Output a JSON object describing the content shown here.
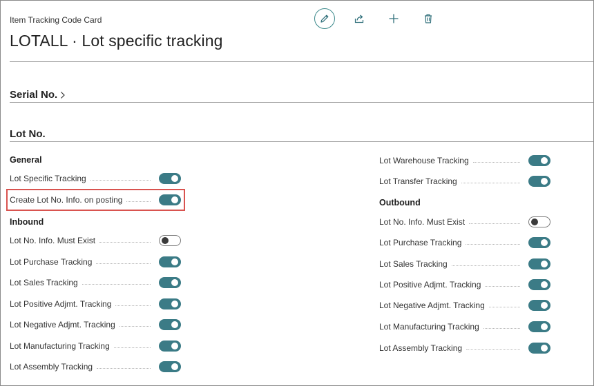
{
  "header": {
    "breadcrumb": "Item Tracking Code Card",
    "title": "LOTALL · Lot specific tracking"
  },
  "toolbar": {
    "icons": [
      "pencil-icon",
      "share-icon",
      "plus-icon",
      "trash-icon"
    ]
  },
  "sections": {
    "serial": "Serial No.",
    "lot": "Lot No."
  },
  "groups": {
    "general": "General",
    "inbound": "Inbound",
    "outbound": "Outbound"
  },
  "general_fields": [
    {
      "label": "Lot Specific Tracking",
      "on": true
    },
    {
      "label": "Create Lot No. Info. on posting",
      "on": true
    }
  ],
  "inbound_fields": [
    {
      "label": "Lot No. Info. Must Exist",
      "on": false
    },
    {
      "label": "Lot Purchase Tracking",
      "on": true
    },
    {
      "label": "Lot Sales Tracking",
      "on": true
    },
    {
      "label": "Lot Positive Adjmt. Tracking",
      "on": true
    },
    {
      "label": "Lot Negative Adjmt. Tracking",
      "on": true
    },
    {
      "label": "Lot Manufacturing Tracking",
      "on": true
    },
    {
      "label": "Lot Assembly Tracking",
      "on": true
    }
  ],
  "right_fields": [
    {
      "label": "Lot Warehouse Tracking",
      "on": true
    },
    {
      "label": "Lot Transfer Tracking",
      "on": true
    }
  ],
  "outbound_fields": [
    {
      "label": "Lot No. Info. Must Exist",
      "on": false
    },
    {
      "label": "Lot Purchase Tracking",
      "on": true
    },
    {
      "label": "Lot Sales Tracking",
      "on": true
    },
    {
      "label": "Lot Positive Adjmt. Tracking",
      "on": true
    },
    {
      "label": "Lot Negative Adjmt. Tracking",
      "on": true
    },
    {
      "label": "Lot Manufacturing Tracking",
      "on": true
    },
    {
      "label": "Lot Assembly Tracking",
      "on": true
    }
  ],
  "colors": {
    "toggle_on": "#3b7b86",
    "highlight": "#d9534f"
  }
}
